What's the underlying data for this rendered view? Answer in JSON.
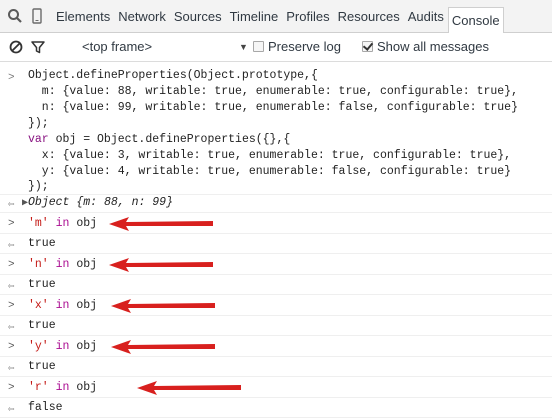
{
  "tabs": [
    "Elements",
    "Network",
    "Sources",
    "Timeline",
    "Profiles",
    "Resources",
    "Audits",
    "Console"
  ],
  "filter": {
    "frame": "<top frame>",
    "preserve_log": "Preserve log",
    "show_all": "Show all messages"
  },
  "console": {
    "cmd1": [
      "Object.defineProperties(Object.prototype,{",
      "  m: {value: 88, writable: true, enumerable: true, configurable: true},",
      "  n: {value: 99, writable: true, enumerable: false, configurable: true}",
      "});"
    ],
    "cmd1b_var": "var",
    "cmd1b_rest": " obj = Object.defineProperties({},{",
    "cmd1c": [
      "  x: {value: 3, writable: true, enumerable: true, configurable: true},",
      "  y: {value: 4, writable: true, enumerable: false, configurable: true}",
      "});"
    ],
    "result1_obj": "Object",
    "result1_props": " {m: 88, n: 99}",
    "entries": [
      {
        "key": "'m'",
        "op": " in ",
        "target": "obj",
        "result": "true"
      },
      {
        "key": "'n'",
        "op": " in ",
        "target": "obj",
        "result": "true"
      },
      {
        "key": "'x'",
        "op": " in ",
        "target": "obj",
        "result": "true"
      },
      {
        "key": "'y'",
        "op": " in ",
        "target": "obj",
        "result": "true"
      },
      {
        "key": "'r'",
        "op": " in ",
        "target": "obj",
        "result": "false"
      }
    ]
  },
  "colors": {
    "arrow": "#d8201e",
    "keyword": "#aa0d91",
    "string": "#c41a16"
  },
  "icons": [
    "search-icon",
    "device-icon",
    "clear-icon",
    "filter-icon",
    "expand-triangle-icon",
    "red-arrow-icon"
  ]
}
